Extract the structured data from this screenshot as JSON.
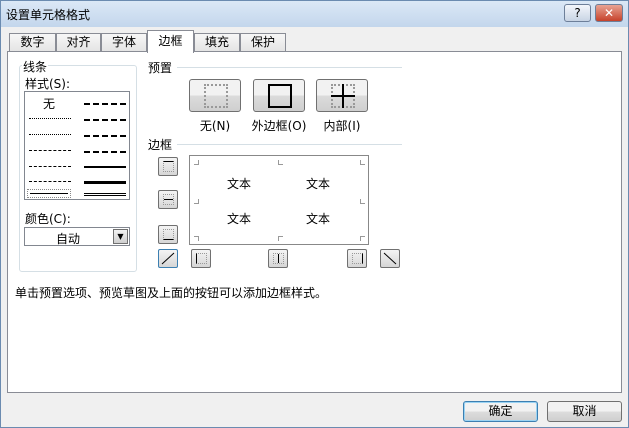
{
  "window": {
    "title": "设置单元格格式",
    "help_label": "?",
    "close_label": "✕"
  },
  "tabs": [
    {
      "label": "数字"
    },
    {
      "label": "对齐"
    },
    {
      "label": "字体"
    },
    {
      "label": "边框",
      "active": true
    },
    {
      "label": "填充"
    },
    {
      "label": "保护"
    }
  ],
  "line": {
    "group_label": "线条",
    "style_label": "样式(S):",
    "none_label": "无",
    "color_label": "颜色(C):",
    "color_value": "自动"
  },
  "presets": {
    "label": "预置",
    "items": [
      {
        "label": "无(N)"
      },
      {
        "label": "外边框(O)"
      },
      {
        "label": "内部(I)"
      }
    ]
  },
  "border": {
    "label": "边框",
    "preview_text": [
      "文本",
      "文本",
      "文本",
      "文本"
    ]
  },
  "hint": "单击预置选项、预览草图及上面的按钮可以添加边框样式。",
  "buttons": {
    "ok": "确定",
    "cancel": "取消"
  }
}
